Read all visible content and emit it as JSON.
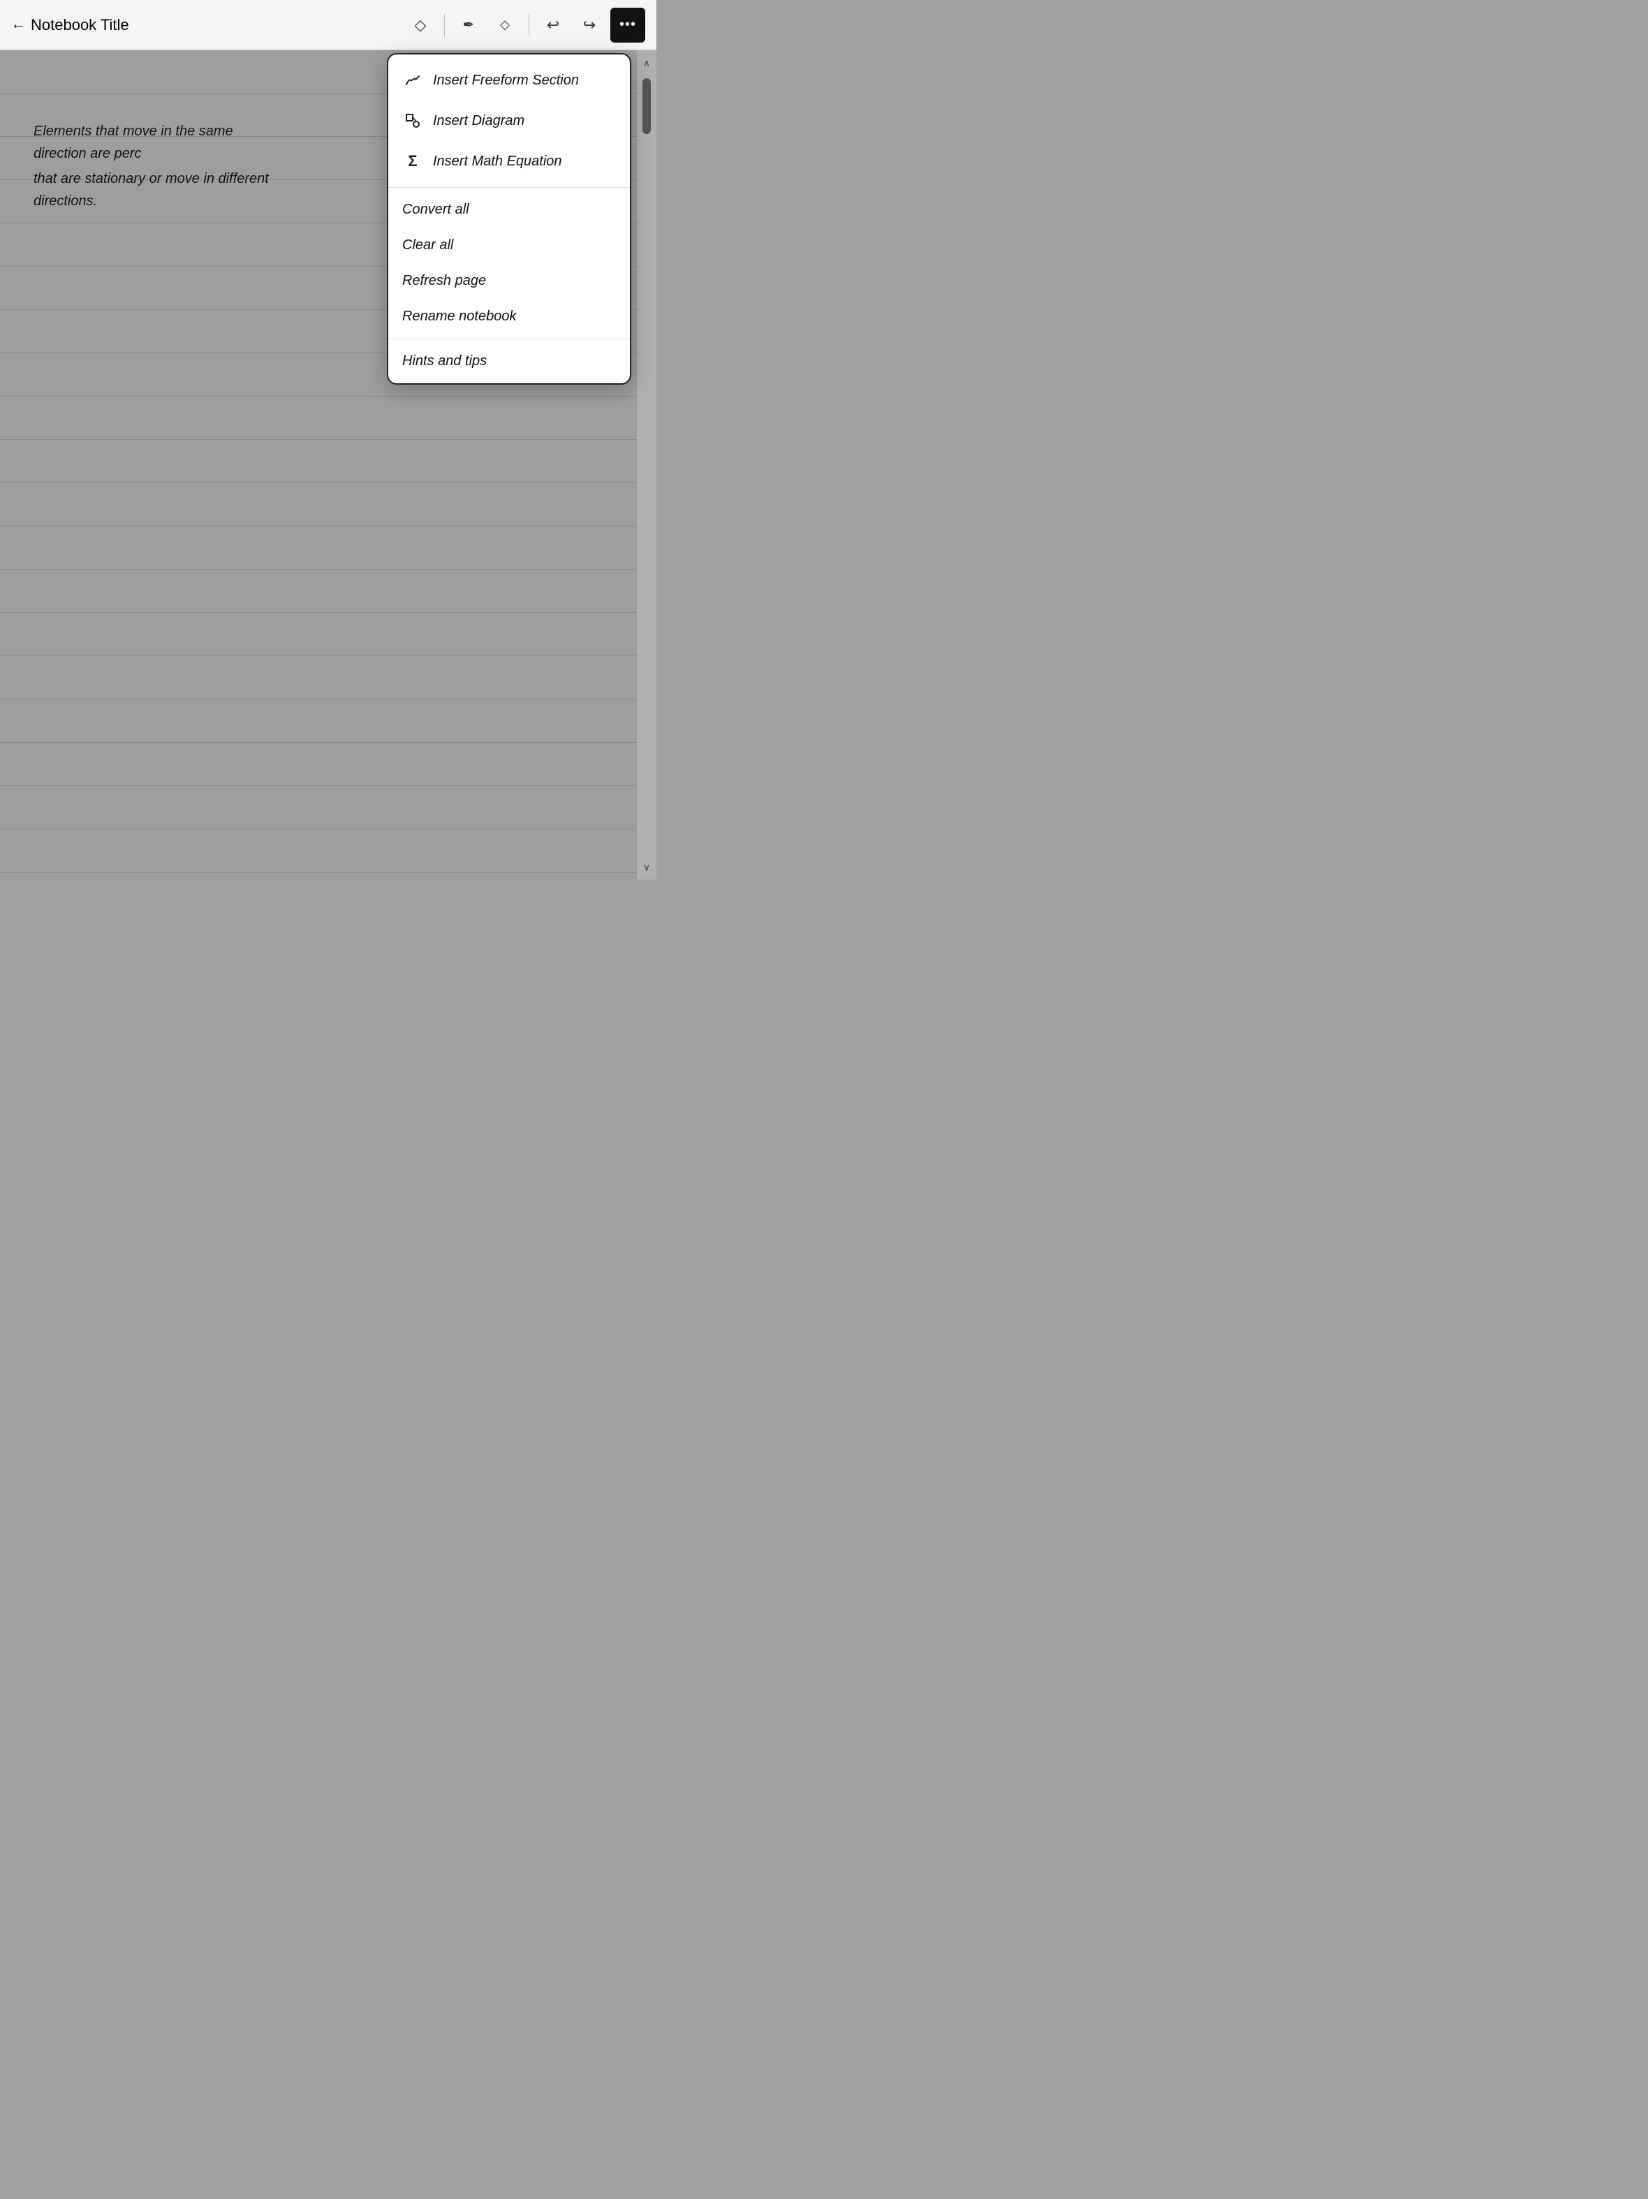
{
  "toolbar": {
    "back_label": "←",
    "title": "Notebook Title",
    "bookmark_icon": "◇",
    "pen_icon": "✒",
    "eraser_icon": "◇",
    "undo_icon": "↩",
    "redo_icon": "↪",
    "more_icon": "•••"
  },
  "page": {
    "text_line1": "Elements that move in the same direction are perc",
    "text_line2": "that are stationary or move in different directions."
  },
  "menu": {
    "insert_section_label": "Insert Freeform Section",
    "insert_section_icon": "𝓜",
    "insert_diagram_label": "Insert Diagram",
    "insert_diagram_icon": "⊡",
    "insert_math_label": "Insert Math Equation",
    "insert_math_icon": "Σ",
    "convert_all_label": "Convert all",
    "clear_all_label": "Clear all",
    "refresh_page_label": "Refresh page",
    "rename_notebook_label": "Rename notebook",
    "hints_tips_label": "Hints and tips"
  },
  "scrollbar": {
    "up_icon": "∧",
    "down_icon": "∨"
  }
}
